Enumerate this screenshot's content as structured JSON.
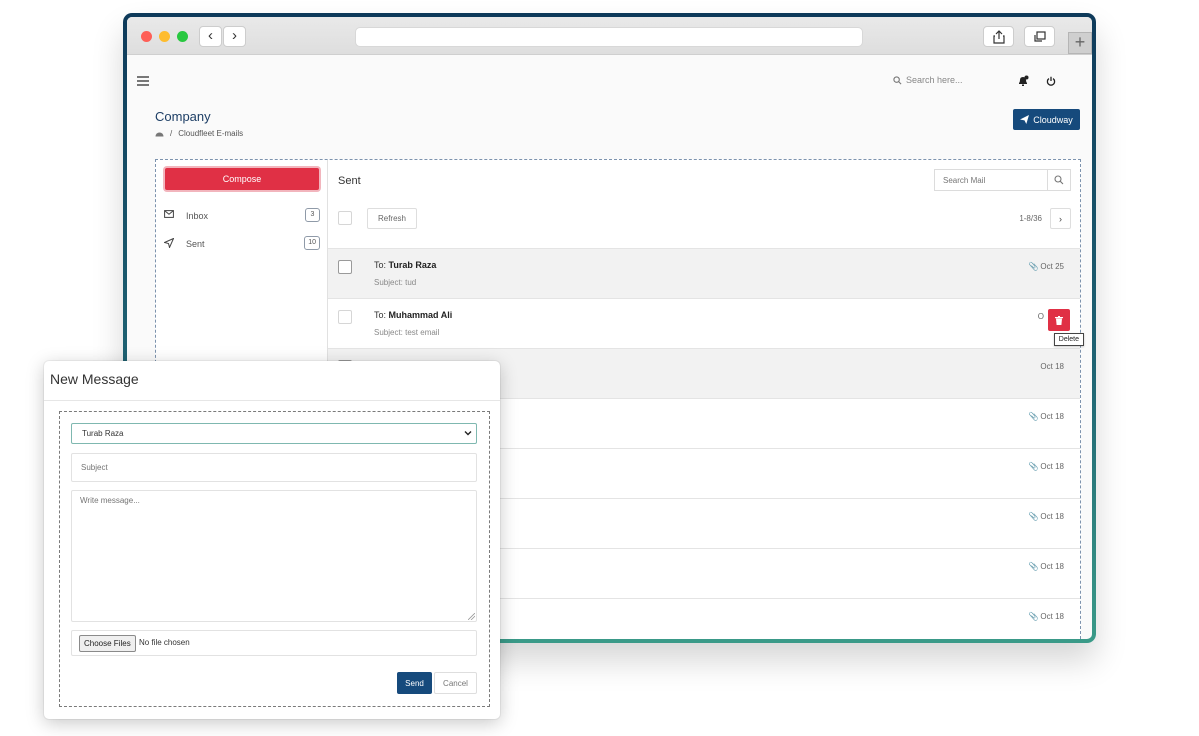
{
  "header": {
    "search_placeholder": "Search here...",
    "page_title": "Company",
    "breadcrumb": "Cloudfleet E-mails",
    "cloudway_label": "Cloudway"
  },
  "sidebar": {
    "compose_label": "Compose",
    "folders": [
      {
        "label": "Inbox",
        "count": "3",
        "icon": "envelope-icon"
      },
      {
        "label": "Sent",
        "count": "10",
        "icon": "send-icon"
      }
    ]
  },
  "mail": {
    "folder_title": "Sent",
    "search_placeholder": "Search Mail",
    "refresh_label": "Refresh",
    "pagination": "1-8/36",
    "delete_tooltip": "Delete",
    "rows": [
      {
        "to_prefix": "To:",
        "to": "Turab Raza",
        "subject": "Subject: tud",
        "date": "Oct 25",
        "attachment": true
      },
      {
        "to_prefix": "To:",
        "to": "Muhammad Ali",
        "subject": "Subject: test email",
        "date": "O",
        "attachment": false
      },
      {
        "date": "Oct 18",
        "attachment": false
      },
      {
        "date": "Oct 18",
        "attachment": true
      },
      {
        "date": "Oct 18",
        "attachment": true
      },
      {
        "date": "Oct 18",
        "attachment": true
      },
      {
        "date": "Oct 18",
        "attachment": true
      },
      {
        "date": "Oct 18",
        "attachment": true
      }
    ]
  },
  "modal": {
    "title": "New Message",
    "to_value": "Turab Raza",
    "subject_placeholder": "Subject",
    "message_placeholder": "Write message...",
    "choose_files_label": "Choose Files",
    "file_status": "No file chosen",
    "send_label": "Send",
    "cancel_label": "Cancel"
  },
  "colors": {
    "primary": "#164a7c",
    "danger": "#e03045",
    "title_blue": "#1e3f66"
  }
}
